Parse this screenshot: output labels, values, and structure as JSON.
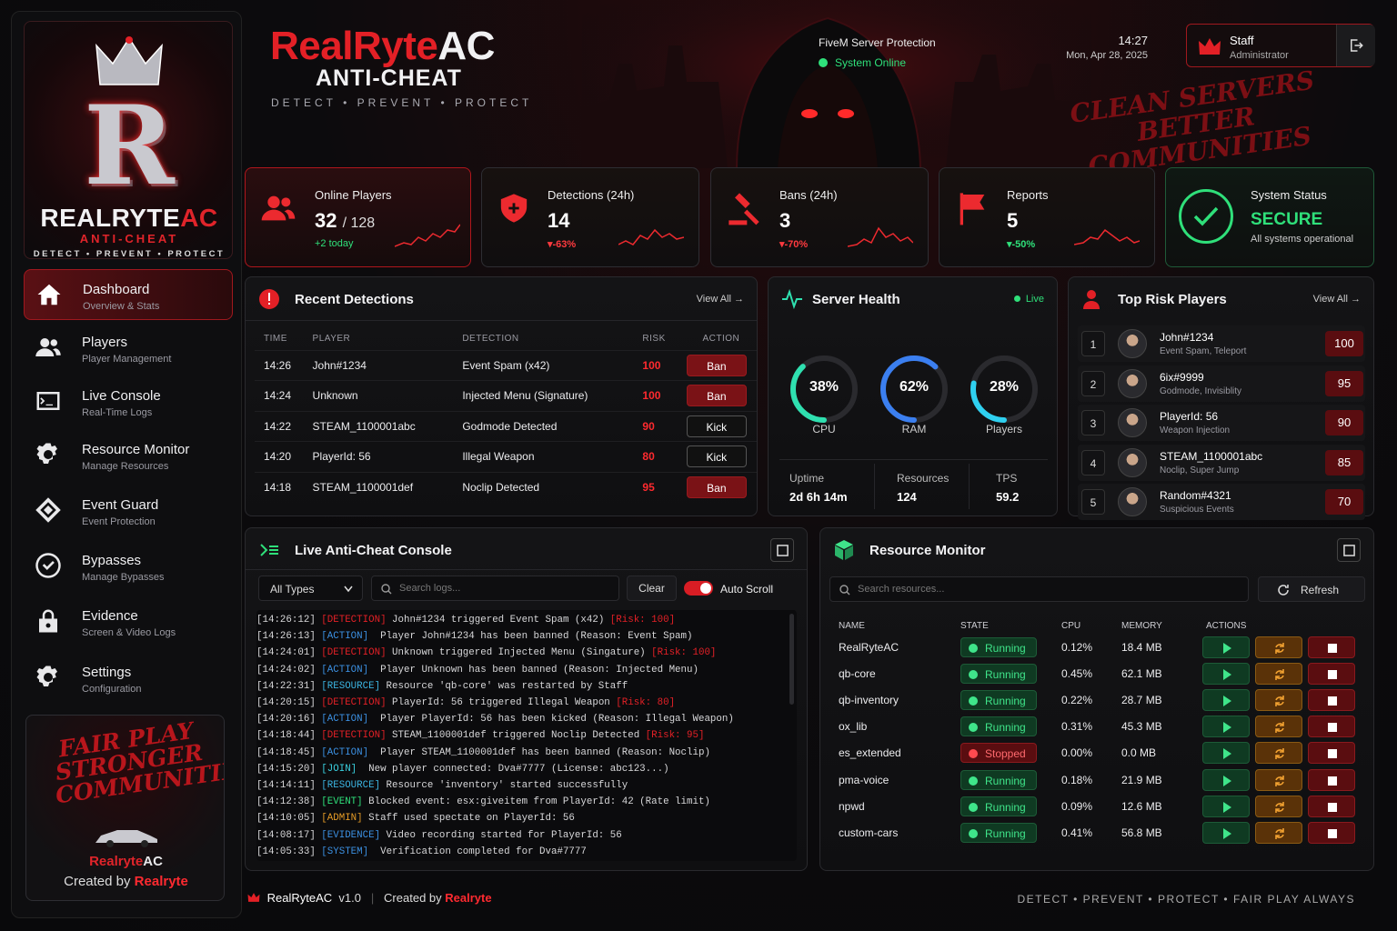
{
  "brand": {
    "logo_name_main": "REALRYTE",
    "logo_name_ac": "AC",
    "logo_sub": "ANTI-CHEAT",
    "logo_tag": "DETECT  •  PREVENT  •  PROTECT"
  },
  "sidebar": {
    "items": [
      {
        "title": "Dashboard",
        "sub": "Overview & Stats",
        "icon": "home-icon"
      },
      {
        "title": "Players",
        "sub": "Player Management",
        "icon": "users-icon"
      },
      {
        "title": "Live Console",
        "sub": "Real-Time Logs",
        "icon": "terminal-icon"
      },
      {
        "title": "Resource Monitor",
        "sub": "Manage Resources",
        "icon": "gear-icon"
      },
      {
        "title": "Event Guard",
        "sub": "Event Protection",
        "icon": "shield-diamond-icon"
      },
      {
        "title": "Bypasses",
        "sub": "Manage Bypasses",
        "icon": "check-circle-icon"
      },
      {
        "title": "Evidence",
        "sub": "Screen & Video Logs",
        "icon": "lock-icon"
      },
      {
        "title": "Settings",
        "sub": "Configuration",
        "icon": "gear-icon"
      }
    ],
    "promo": {
      "script": "FAIR PLAY STRONGER COMMUNITIES",
      "brand_a": "Realryte",
      "brand_b": "AC",
      "created_by": "Created by",
      "author": "Realryte"
    }
  },
  "header": {
    "title_a": "RealRyte",
    "title_b": "AC",
    "subtitle": "ANTI-CHEAT",
    "tagline": "DETECT  •  PREVENT  •  PROTECT",
    "fivem": "FiveM Server Protection",
    "status": "System Online",
    "time": "14:27",
    "date": "Mon, Apr 28, 2025",
    "user_name": "Staff",
    "user_role": "Administrator",
    "slogan": "CLEAN SERVERS BETTER COMMUNITIES"
  },
  "stats": {
    "online": {
      "label": "Online Players",
      "value": "32",
      "max": "/ 128",
      "change": "+2 today"
    },
    "detections": {
      "label": "Detections (24h)",
      "value": "14",
      "change": "▾-63%"
    },
    "bans": {
      "label": "Bans (24h)",
      "value": "3",
      "change": "▾-70%"
    },
    "reports": {
      "label": "Reports",
      "value": "5",
      "change": "▾-50%"
    },
    "system": {
      "label": "System Status",
      "value": "SECURE",
      "sub": "All systems operational"
    }
  },
  "detections": {
    "title": "Recent Detections",
    "view_all": "View All →",
    "headers": [
      "TIME",
      "PLAYER",
      "DETECTION",
      "RISK",
      "ACTION"
    ],
    "rows": [
      {
        "time": "14:26",
        "player": "John#1234",
        "detection": "Event Spam (x42)",
        "risk": "100",
        "action": "Ban"
      },
      {
        "time": "14:24",
        "player": "Unknown",
        "detection": "Injected Menu (Signature)",
        "risk": "100",
        "action": "Ban"
      },
      {
        "time": "14:22",
        "player": "STEAM_1100001abc",
        "detection": "Godmode Detected",
        "risk": "90",
        "action": "Kick"
      },
      {
        "time": "14:20",
        "player": "PlayerId: 56",
        "detection": "Illegal Weapon",
        "risk": "80",
        "action": "Kick"
      },
      {
        "time": "14:18",
        "player": "STEAM_1100001def",
        "detection": "Noclip Detected",
        "risk": "95",
        "action": "Ban"
      }
    ]
  },
  "health": {
    "title": "Server Health",
    "live": "Live",
    "gauges": [
      {
        "label": "CPU",
        "value": "38%",
        "pct": 38,
        "color": "#2fe0b0"
      },
      {
        "label": "RAM",
        "value": "62%",
        "pct": 62,
        "color": "#3b7ff0"
      },
      {
        "label": "Players",
        "value": "28%",
        "pct": 28,
        "color": "#2fd0f0"
      }
    ],
    "uptime_label": "Uptime",
    "uptime": "2d 6h 14m",
    "resources_label": "Resources",
    "resources": "124",
    "tps_label": "TPS",
    "tps": "59.2"
  },
  "risk": {
    "title": "Top Risk Players",
    "view_all": "View All →",
    "rows": [
      {
        "rank": "1",
        "name": "John#1234",
        "desc": "Event Spam, Teleport",
        "score": "100"
      },
      {
        "rank": "2",
        "name": "6ix#9999",
        "desc": "Godmode, Invisiblity",
        "score": "95"
      },
      {
        "rank": "3",
        "name": "PlayerId: 56",
        "desc": "Weapon Injection",
        "score": "90"
      },
      {
        "rank": "4",
        "name": "STEAM_1100001abc",
        "desc": "Noclip, Super Jump",
        "score": "85"
      },
      {
        "rank": "5",
        "name": "Random#4321",
        "desc": "Suspicious Events",
        "score": "70"
      }
    ]
  },
  "console": {
    "title": "Live Anti-Cheat Console",
    "filter": "All Types",
    "search_placeholder": "Search logs...",
    "clear": "Clear",
    "autoscroll": "Auto Scroll",
    "lines": [
      [
        "[14:26:12]",
        "[DETECTION]",
        "det",
        " John#1234 triggered Event Spam (x42) ",
        "[Risk: 100]"
      ],
      [
        "[14:26:13]",
        "[ACTION]",
        "act",
        "  Player John#1234 has been banned (Reason: Event Spam)",
        ""
      ],
      [
        "[14:24:01]",
        "[DETECTION]",
        "det",
        " Unknown triggered Injected Menu (Singature) ",
        "[Risk: 100]"
      ],
      [
        "[14:24:02]",
        "[ACTION]",
        "act",
        "  Player Unknown has been banned (Reason: Injected Menu)",
        ""
      ],
      [
        "[14:22:31]",
        "[RESOURCE]",
        "res",
        " Resource 'qb-core' was restarted by Staff",
        ""
      ],
      [
        "[14:20:15]",
        "[DETECTION]",
        "det",
        " PlayerId: 56 triggered Illegal Weapon ",
        "[Risk: 80]"
      ],
      [
        "[14:20:16]",
        "[ACTION]",
        "act",
        "  Player PlayerId: 56 has been kicked (Reason: Illegal Weapon)",
        ""
      ],
      [
        "[14:18:44]",
        "[DETECTION]",
        "det",
        " STEAM_1100001def triggered Noclip Detected ",
        "[Risk: 95]"
      ],
      [
        "[14:18:45]",
        "[ACTION]",
        "act",
        "  Player STEAM_1100001def has been banned (Reason: Noclip)",
        ""
      ],
      [
        "[14:15:20]",
        "[JOIN]",
        "join",
        "  New player connected: Dva#7777 (License: abc123...)",
        ""
      ],
      [
        "[14:14:11]",
        "[RESOURCE]",
        "res",
        " Resource 'inventory' started successfully",
        ""
      ],
      [
        "[14:12:38]",
        "[EVENT]",
        "ev",
        " Blocked event: esx:giveitem from PlayerId: 42 (Rate limit)",
        ""
      ],
      [
        "[14:10:05]",
        "[ADMIN]",
        "adm",
        " Staff used spectate on PlayerId: 56",
        ""
      ],
      [
        "[14:08:17]",
        "[EVIDENCE]",
        "evd",
        " Video recording started for PlayerId: 56",
        ""
      ],
      [
        "[14:05:33]",
        "[SYSTEM]",
        "sys",
        "  Verification completed for Dva#7777",
        ""
      ]
    ]
  },
  "resources": {
    "title": "Resource Monitor",
    "search_placeholder": "Search resources...",
    "refresh": "Refresh",
    "headers": [
      "NAME",
      "STATE",
      "CPU",
      "MEMORY",
      "ACTIONS"
    ],
    "rows": [
      {
        "name": "RealRyteAC",
        "state": "Running",
        "cpu": "0.12%",
        "mem": "18.4 MB"
      },
      {
        "name": "qb-core",
        "state": "Running",
        "cpu": "0.45%",
        "mem": "62.1 MB"
      },
      {
        "name": "qb-inventory",
        "state": "Running",
        "cpu": "0.22%",
        "mem": "28.7 MB"
      },
      {
        "name": "ox_lib",
        "state": "Running",
        "cpu": "0.31%",
        "mem": "45.3 MB"
      },
      {
        "name": "es_extended",
        "state": "Stopped",
        "cpu": "0.00%",
        "mem": "0.0 MB"
      },
      {
        "name": "pma-voice",
        "state": "Running",
        "cpu": "0.18%",
        "mem": "21.9 MB"
      },
      {
        "name": "npwd",
        "state": "Running",
        "cpu": "0.09%",
        "mem": "12.6 MB"
      },
      {
        "name": "custom-cars",
        "state": "Running",
        "cpu": "0.41%",
        "mem": "56.8 MB"
      }
    ]
  },
  "footer": {
    "brand": "RealRyteAC",
    "version": "v1.0",
    "sep": "|",
    "created": "Created by",
    "author": "Realryte",
    "tagline": "DETECT  •  PREVENT  •  PROTECT  •  FAIR PLAY ALWAYS"
  }
}
